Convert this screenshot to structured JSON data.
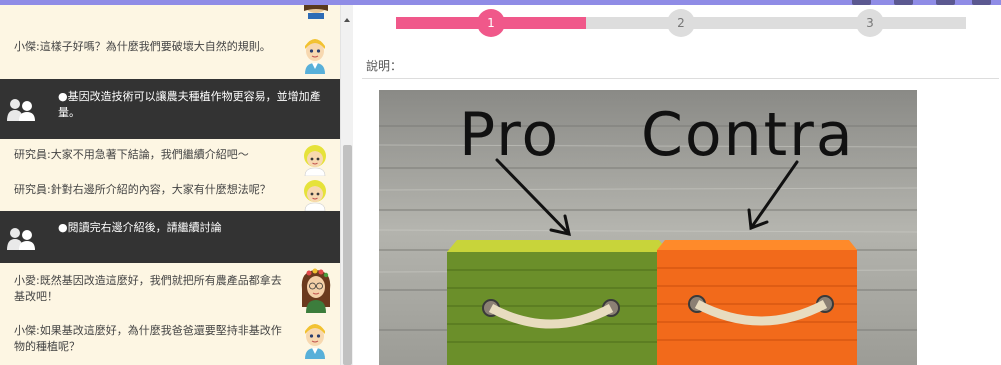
{
  "chat": {
    "messages": [
      {
        "type": "user",
        "text": "小傑:這樣子好嗎？為什麼我們要破壞大自然的規則。",
        "avatar": "boy-avatar"
      },
      {
        "type": "notice",
        "text": "●基因改造技術可以讓農夫種植作物更容易，並增加產量。",
        "icon": "group-icon"
      },
      {
        "type": "user",
        "text": "研究員:大家不用急著下結論，我們繼續介紹吧～",
        "avatar": "researcher-avatar"
      },
      {
        "type": "user",
        "text": "研究員:針對右邊所介紹的內容，大家有什麼想法呢？",
        "avatar": "researcher-avatar"
      },
      {
        "type": "notice",
        "text": "●閱讀完右邊介紹後，請繼續討論",
        "icon": "group-icon"
      },
      {
        "type": "user",
        "text": "小愛:既然基因改造這麼好，我們就把所有農產品都拿去基改吧！",
        "avatar": "girl-avatar"
      },
      {
        "type": "user",
        "text": "小傑:如果基改這麼好，為什麼我爸爸還要堅持非基改作物的種植呢？",
        "avatar": "boy-avatar"
      }
    ]
  },
  "stepper": {
    "steps": [
      "1",
      "2",
      "3"
    ],
    "current": 1,
    "progress": 0.333
  },
  "description": {
    "label": "說明："
  },
  "picture": {
    "words": [
      "Pro",
      "Contra"
    ],
    "colors": {
      "left_basket": "#6b8f2a",
      "right_basket": "#f26a1b"
    }
  },
  "colors": {
    "accent": "#f0588a",
    "topbar": "#8f8ce6",
    "chat_bg": "#fdf6e3",
    "notice_bg": "#333333"
  }
}
